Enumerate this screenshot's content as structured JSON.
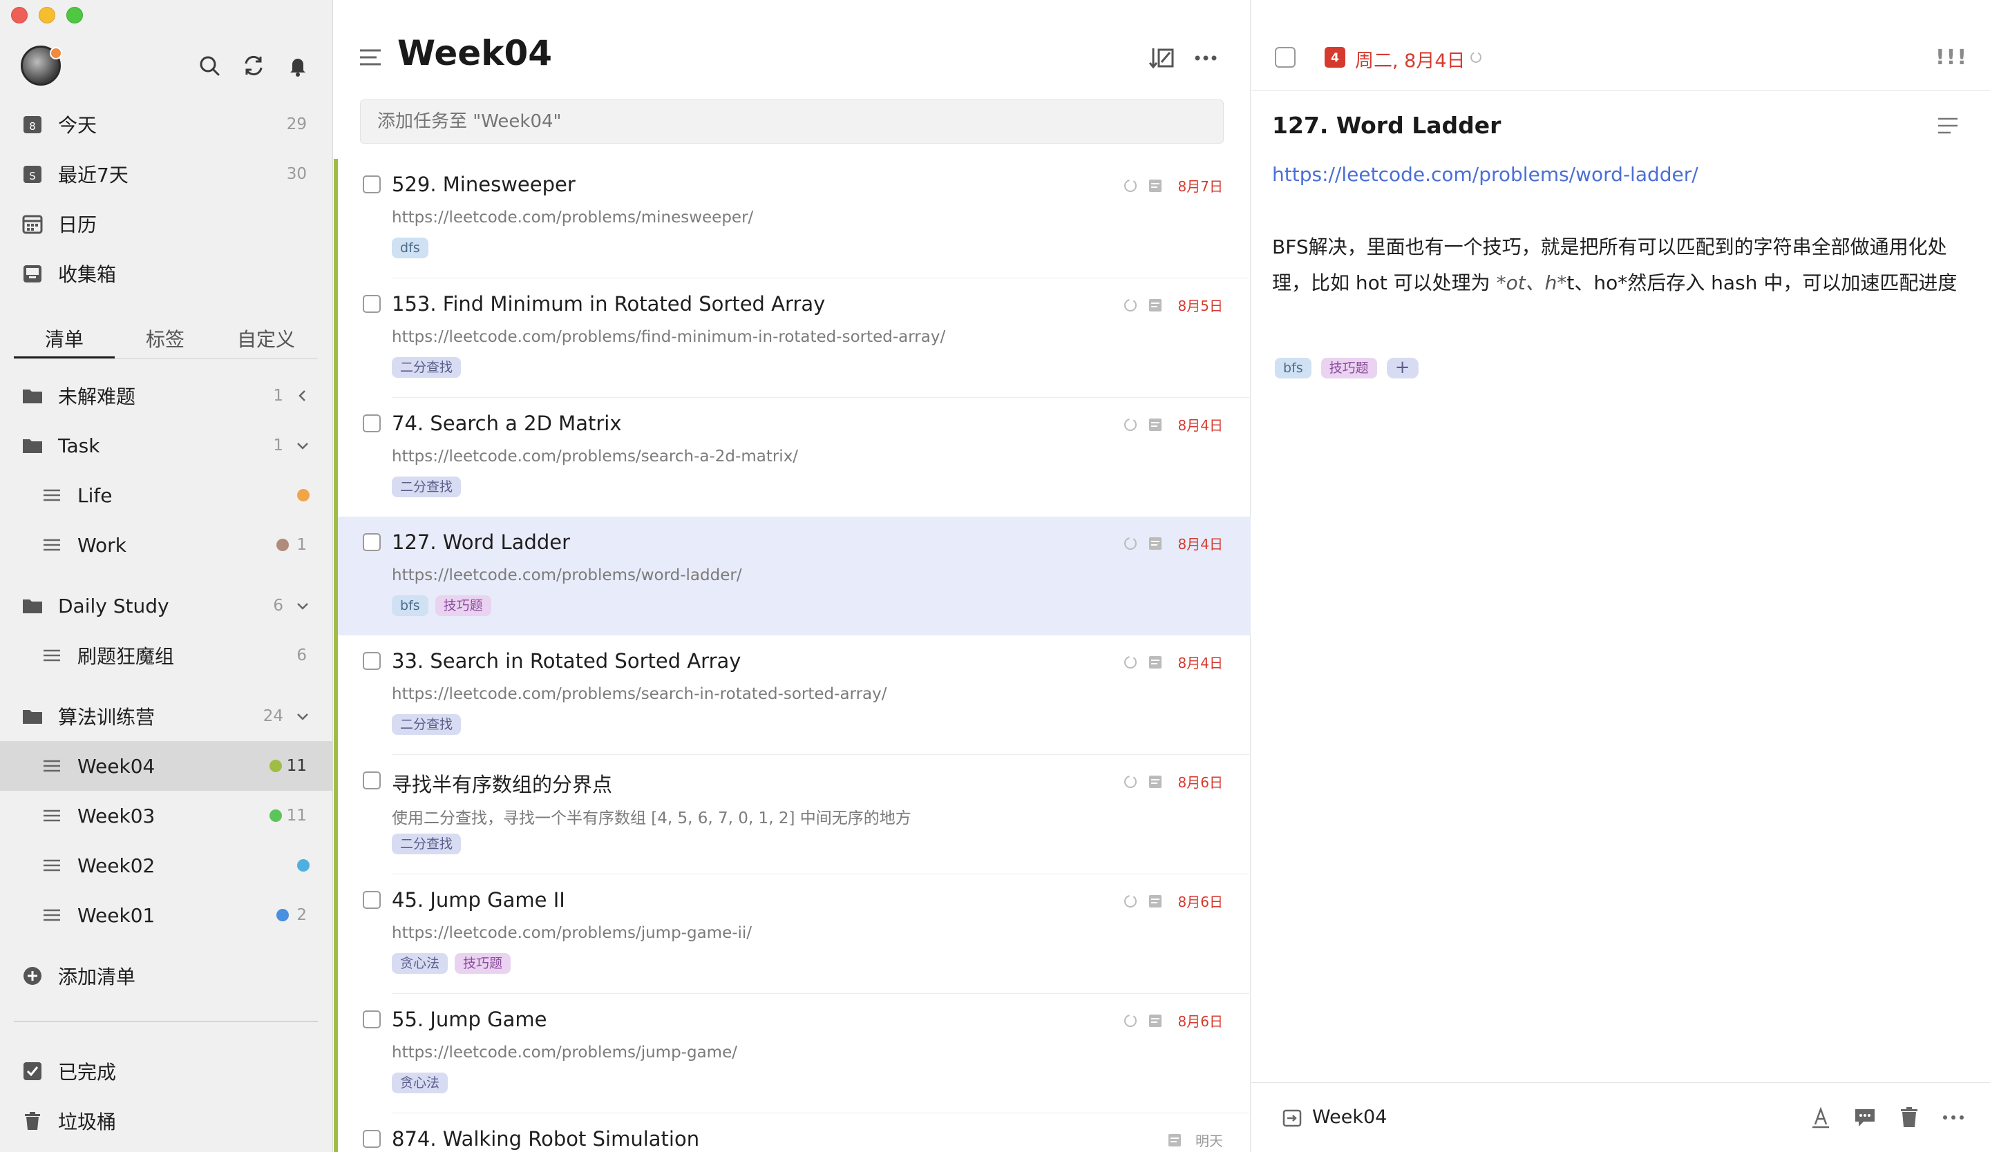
{
  "sidebar": {
    "nav": [
      {
        "label": "今天",
        "count": "29",
        "icon_text": "8"
      },
      {
        "label": "最近7天",
        "count": "30",
        "icon_text": "S"
      },
      {
        "label": "日历",
        "count": ""
      },
      {
        "label": "收集箱",
        "count": ""
      }
    ],
    "segments": [
      "清单",
      "标签",
      "自定义"
    ],
    "folders": [
      {
        "label": "未解难题",
        "count": "1"
      },
      {
        "label": "Task",
        "count": "1"
      },
      {
        "label": "Life",
        "count": "",
        "color": "#f0a54a"
      },
      {
        "label": "Work",
        "count": "1",
        "color": "#b08c7c"
      },
      {
        "label": "Daily Study",
        "count": "6"
      },
      {
        "label": "刷题狂魔组",
        "count": "6"
      },
      {
        "label": "算法训练营",
        "count": "24"
      },
      {
        "label": "Week04",
        "count": "11",
        "color": "#9fbd45"
      },
      {
        "label": "Week03",
        "count": "11",
        "color": "#5cc45a"
      },
      {
        "label": "Week02",
        "count": "",
        "color": "#4fb0e0"
      },
      {
        "label": "Week01",
        "count": "2",
        "color": "#4a8fe0"
      }
    ],
    "add_list": "添加清单",
    "completed": "已完成",
    "trash": "垃圾桶"
  },
  "list": {
    "title": "Week04",
    "add_placeholder": "添加任务至 \"Week04\"",
    "tasks": [
      {
        "title": "529. Minesweeper",
        "sub": "https://leetcode.com/problems/minesweeper/",
        "tags": [
          "dfs"
        ],
        "date": "8月7日"
      },
      {
        "title": "153. Find Minimum in Rotated Sorted Array",
        "sub": "https://leetcode.com/problems/find-minimum-in-rotated-sorted-array/",
        "tags": [
          "二分查找"
        ],
        "date": "8月5日"
      },
      {
        "title": "74. Search a 2D Matrix",
        "sub": "https://leetcode.com/problems/search-a-2d-matrix/",
        "tags": [
          "二分查找"
        ],
        "date": "8月4日"
      },
      {
        "title": "127. Word Ladder",
        "sub": "https://leetcode.com/problems/word-ladder/",
        "tags": [
          "bfs",
          "技巧题"
        ],
        "date": "8月4日"
      },
      {
        "title": "33. Search in Rotated Sorted Array",
        "sub": "https://leetcode.com/problems/search-in-rotated-sorted-array/",
        "tags": [
          "二分查找"
        ],
        "date": "8月4日"
      },
      {
        "title": "寻找半有序数组的分界点",
        "sub": "使用二分查找，寻找一个半有序数组 [4, 5, 6, 7, 0, 1, 2] 中间无序的地方",
        "tags": [
          "二分查找"
        ],
        "date": "8月6日"
      },
      {
        "title": "45. Jump Game II",
        "sub": "https://leetcode.com/problems/jump-game-ii/",
        "tags": [
          "贪心法",
          "技巧题"
        ],
        "date": "8月6日"
      },
      {
        "title": "55. Jump Game",
        "sub": "https://leetcode.com/problems/jump-game/",
        "tags": [
          "贪心法"
        ],
        "date": "8月6日"
      },
      {
        "title": "874. Walking Robot Simulation",
        "sub": "",
        "tags": [],
        "date": "明天"
      }
    ]
  },
  "detail": {
    "cal_day": "4",
    "date": "周二, 8月4日",
    "priority": "!!!",
    "title": "127. Word Ladder",
    "link": "https://leetcode.com/problems/word-ladder/",
    "desc_line1": "BFS解决，里面也有一个技巧，就是把所有可以匹配到的字符串全部做通用化处",
    "desc_line2_a": "理，比如 hot 可以处理为 ",
    "desc_line2_b": "*ot、h*",
    "desc_line2_c": "t、ho*然后存入 hash 中，可以加速匹配进度",
    "tags": [
      "bfs",
      "技巧题"
    ],
    "plus": "+",
    "list_name": "Week04"
  }
}
